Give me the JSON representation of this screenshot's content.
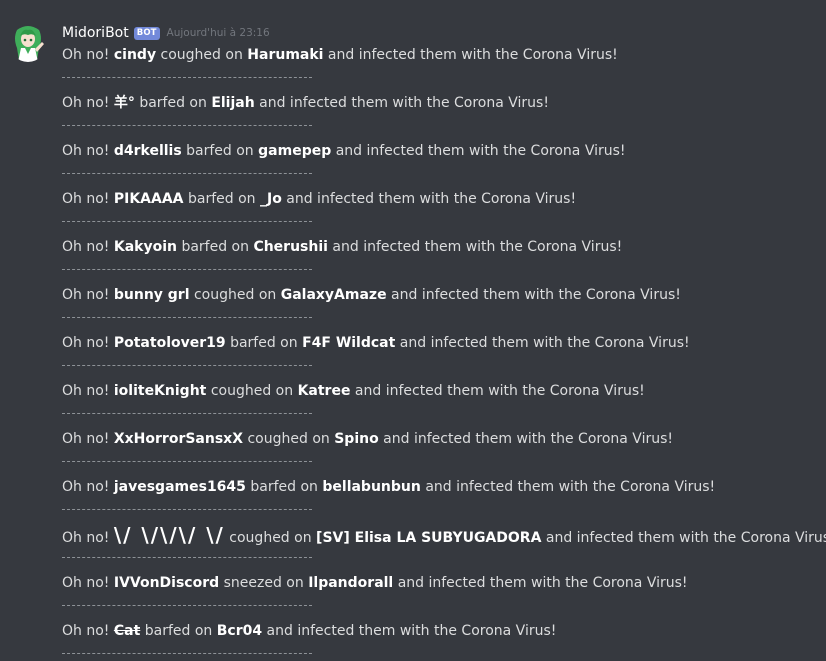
{
  "author": {
    "name": "MidoriBot",
    "tag": "BOT",
    "timestamp": "Aujourd'hui à 23:16"
  },
  "separator": "-------------------------------------------",
  "entries": [
    {
      "prefix": "Oh no!",
      "attacker": "cindy",
      "verb": "coughed on",
      "victim": "Harumaki",
      "suffix": "and infected them with the Corona Virus!"
    },
    {
      "prefix": "Oh no!",
      "attacker": "羊°",
      "verb": "barfed on",
      "victim": "Elijah",
      "suffix": "and infected them with the Corona Virus!"
    },
    {
      "prefix": "Oh no!",
      "attacker": "d4rkellis",
      "verb": "barfed on",
      "victim": "gamepep",
      "suffix": "and infected them with the Corona Virus!"
    },
    {
      "prefix": "Oh no!",
      "attacker": "PIKAAAA",
      "verb": "barfed on",
      "victim": "_Jo",
      "suffix": "and infected them with the Corona Virus!"
    },
    {
      "prefix": "Oh no!",
      "attacker": "Kakyoin",
      "verb": "barfed on",
      "victim": "Cherushii",
      "suffix": "and infected them with the Corona Virus!"
    },
    {
      "prefix": "Oh no!",
      "attacker": "bunny grl",
      "verb": "coughed on",
      "victim": "GalaxyAmaze",
      "suffix": "and infected them with the Corona Virus!"
    },
    {
      "prefix": "Oh no!",
      "attacker": "Potatolover19",
      "verb": "barfed on",
      "victim": "F4F Wildcat",
      "suffix": "and infected them with the Corona Virus!"
    },
    {
      "prefix": "Oh no!",
      "attacker": "ioliteKnight",
      "verb": "coughed on",
      "victim": "Katree",
      "suffix": "and infected them with the Corona Virus!"
    },
    {
      "prefix": "Oh no!",
      "attacker": "XxHorrorSansxX",
      "verb": "coughed on",
      "victim": "Spino",
      "suffix": "and infected them with the Corona Virus!"
    },
    {
      "prefix": "Oh no!",
      "attacker": "javesgames1645",
      "verb": "barfed on",
      "victim": "bellabunbun",
      "suffix": "and infected them with the Corona Virus!"
    },
    {
      "prefix": "Oh no!",
      "attacker": "\\/ \\/\\/\\/ \\/",
      "verb": "coughed on",
      "victim": "[SV] Elisa LA SUBYUGADORA",
      "suffix": "and infected them with the Corona Virus!"
    },
    {
      "prefix": "Oh no!",
      "attacker": "IVVonDiscord",
      "verb": "sneezed on",
      "victim": "Ilpandorall",
      "suffix": "and infected them with the Corona Virus!"
    },
    {
      "prefix": "Oh no!",
      "attacker": "Cat",
      "verb": "barfed on",
      "victim": "Bcr04",
      "suffix": "and infected them with the Corona Virus!"
    }
  ],
  "colors": {
    "background": "#36393f",
    "text": "#dcddde",
    "username": "#ffffff",
    "bot_tag": "#7289da",
    "timestamp": "#72767d"
  }
}
